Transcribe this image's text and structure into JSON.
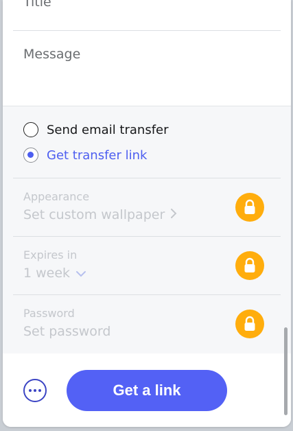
{
  "form": {
    "title_placeholder": "Title",
    "message_placeholder": "Message"
  },
  "transfer_type": {
    "options": [
      {
        "label": "Send email transfer",
        "selected": false
      },
      {
        "label": "Get transfer link",
        "selected": true
      }
    ]
  },
  "options": {
    "appearance": {
      "label": "Appearance",
      "value": "Set custom wallpaper",
      "icon": "chevron-right-icon",
      "locked": true
    },
    "expires": {
      "label": "Expires in",
      "value": "1 week",
      "icon": "chevron-down-icon",
      "locked": true
    },
    "password": {
      "label": "Password",
      "value": "Set password",
      "locked": true
    }
  },
  "footer": {
    "more_icon": "more-icon",
    "primary_label": "Get a link"
  },
  "colors": {
    "accent": "#5361f5",
    "lock_badge": "#ffad0d",
    "selected_text": "#4d5ef0"
  }
}
